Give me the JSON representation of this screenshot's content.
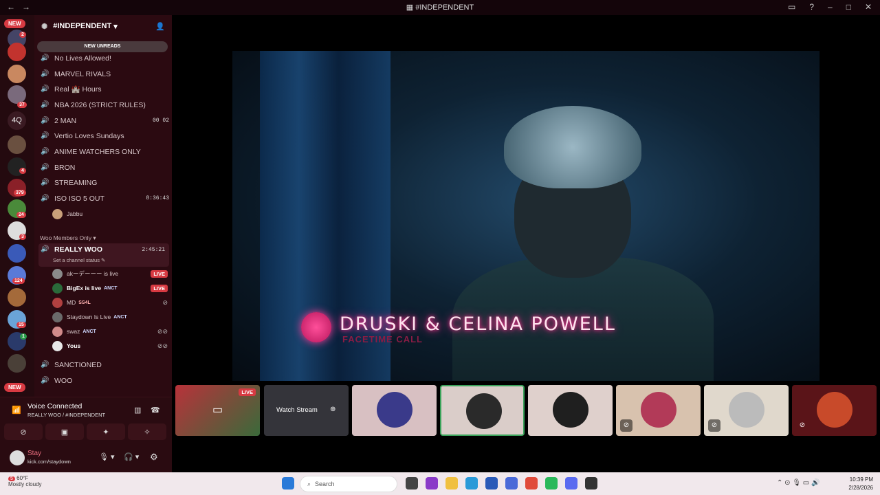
{
  "window": {
    "title": "#INDEPENDENT"
  },
  "server": {
    "name": "#INDEPENDENT",
    "new_unreads": "NEW UNREADS"
  },
  "server_badges": {
    "new_top": "NEW",
    "b1": "2",
    "b2": "37",
    "q4": "4Q",
    "b3": "4",
    "b4": "379",
    "b5": "24",
    "b6": "3",
    "b7": "124",
    "b8": "15",
    "b9": "1",
    "new_bottom": "NEW"
  },
  "channels": [
    {
      "name": "No Lives Allowed!",
      "right": ""
    },
    {
      "name": "MARVEL RIVALS",
      "right": ""
    },
    {
      "name": "Real 🏰 Hours",
      "right": ""
    },
    {
      "name": "NBA 2026 (STRICT RULES)",
      "right": ""
    },
    {
      "name": "2 MAN",
      "right": "00 02"
    },
    {
      "name": "Vertio Loves Sundays",
      "right": ""
    },
    {
      "name": "ANIME WATCHERS ONLY",
      "right": ""
    },
    {
      "name": "BRON",
      "right": ""
    },
    {
      "name": "STREAMING",
      "right": ""
    },
    {
      "name": "ISO ISO 5 OUT",
      "right": "8:36:43"
    }
  ],
  "iso_user": "Jabbu",
  "category": "Woo Members Only",
  "active_channel": {
    "name": "REALLY WOO",
    "time": "2:45:21",
    "status": "Set a channel status"
  },
  "woo_users": [
    {
      "name": "akーデーーー is live",
      "tag": "",
      "live": "LIVE"
    },
    {
      "name": "BigEx is live",
      "tag": "ANCT",
      "live": "LIVE"
    },
    {
      "name": "MD",
      "tag": "SS4L",
      "live": ""
    },
    {
      "name": "Staydown Is Live",
      "tag": "ANCT",
      "live": ""
    },
    {
      "name": "swaz",
      "tag": "ANCT",
      "live": ""
    },
    {
      "name": "Yous",
      "tag": "",
      "live": ""
    }
  ],
  "more_channels": [
    "SANCTIONED",
    "WOO"
  ],
  "voice": {
    "status": "Voice Connected",
    "location": "REALLY WOO / #INDEPENDENT"
  },
  "userbar": {
    "name": "Stay",
    "status": "kick.com/staydown"
  },
  "stream": {
    "title": "DRUSKI & CELINA POWELL",
    "subtitle": "FACETIME CALL"
  },
  "tiles": {
    "live": "LIVE",
    "watch": "Watch Stream"
  },
  "taskbar": {
    "temp": "60°F",
    "weather": "Mostly cloudy",
    "search": "Search",
    "time": "10:39 PM",
    "date": "2/28/2026",
    "weather_badge": "5"
  }
}
